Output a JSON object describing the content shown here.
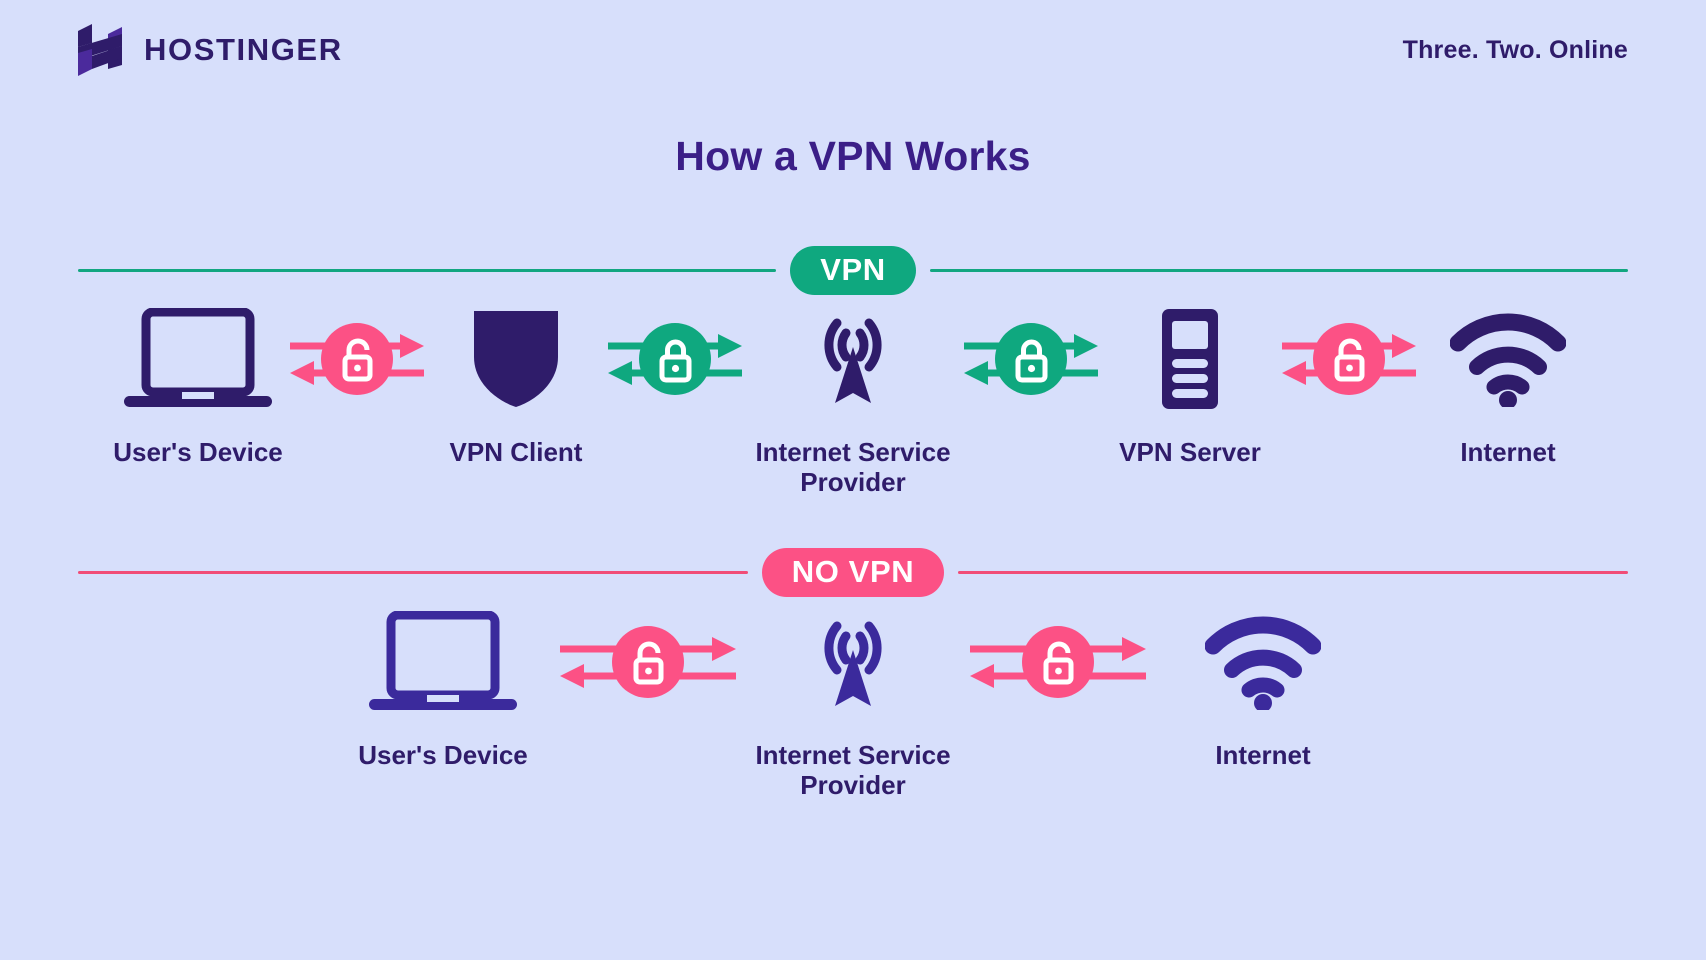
{
  "brand": {
    "logo_icon": "hostinger-h-logo",
    "name": "HOSTINGER",
    "tagline": "Three. Two. Online"
  },
  "page_title": "How a VPN Works",
  "colors": {
    "background": "#d7dffb",
    "purple": "#2f1c6a",
    "title_purple": "#3b1e87",
    "green": "#0fa87f",
    "green_line": "#12a680",
    "pink": "#fc5185",
    "pink_line": "#f14d77",
    "white": "#ffffff"
  },
  "sections": [
    {
      "id": "vpn",
      "badge": "VPN",
      "badge_color": "#0fa87f",
      "line_color": "#12a680",
      "nodes": [
        {
          "label": "User's Device",
          "icon": "laptop-icon"
        },
        {
          "label": "VPN Client",
          "icon": "shield-icon"
        },
        {
          "label": "Internet Service\nProvider",
          "icon": "broadcast-tower-icon"
        },
        {
          "label": "VPN Server",
          "icon": "server-icon"
        },
        {
          "label": "Internet",
          "icon": "wifi-icon"
        }
      ],
      "connectors": [
        {
          "icon": "unlocked-padlock-icon",
          "state": "unlocked",
          "color": "#fc5185"
        },
        {
          "icon": "locked-padlock-icon",
          "state": "locked",
          "color": "#0fa87f"
        },
        {
          "icon": "locked-padlock-icon",
          "state": "locked",
          "color": "#0fa87f"
        },
        {
          "icon": "unlocked-padlock-icon",
          "state": "unlocked",
          "color": "#fc5185"
        }
      ]
    },
    {
      "id": "no-vpn",
      "badge": "NO VPN",
      "badge_color": "#fc5185",
      "line_color": "#f14d77",
      "nodes": [
        {
          "label": "User's Device",
          "icon": "laptop-icon"
        },
        {
          "label": "Internet Service\nProvider",
          "icon": "broadcast-tower-icon"
        },
        {
          "label": "Internet",
          "icon": "wifi-icon"
        }
      ],
      "connectors": [
        {
          "icon": "unlocked-padlock-icon",
          "state": "unlocked",
          "color": "#fc5185"
        },
        {
          "icon": "unlocked-padlock-icon",
          "state": "unlocked",
          "color": "#fc5185"
        }
      ]
    }
  ]
}
